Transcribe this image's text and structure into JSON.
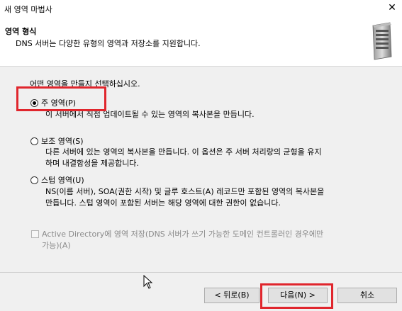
{
  "window": {
    "title": "새 영역 마법사",
    "close_glyph": "✕"
  },
  "header": {
    "title": "영역 형식",
    "subtitle": "DNS 서버는 다양한 유형의 영역과 저장소를 지원합니다."
  },
  "prompt": "어떤 영역을 만들지 선택하십시오.",
  "options": [
    {
      "label": "주 영역(P)",
      "checked": true,
      "description": "이 서버에서 직접 업데이트될 수 있는 영역의 복사본을 만듭니다."
    },
    {
      "label": "보조 영역(S)",
      "checked": false,
      "description_lines": [
        "다른 서버에 있는 영역의 복사본을 만듭니다. 이 옵션은 주 서버 처리량의 균형을 유지",
        "하며 내결함성을 제공합니다."
      ]
    },
    {
      "label": "스텁 영역(U)",
      "checked": false,
      "description_lines": [
        "NS(이름 서버), SOA(권한 시작) 및 글루 호스트(A) 레코드만 포함된 영역의 복사본을",
        "만듭니다. 스텁 영역이 포함된 서버는 해당 영역에 대한 권한이 없습니다."
      ]
    }
  ],
  "ad_checkbox": {
    "lines": [
      "Active Directory에 영역 저장(DNS 서버가 쓰기 가능한 도메인 컨트롤러인 경우에만",
      "가능)(A)"
    ],
    "checked": false,
    "enabled": false
  },
  "buttons": {
    "back": "< 뒤로(B)",
    "next": "다음(N) >",
    "cancel": "취소"
  },
  "colors": {
    "highlight": "#e0262d",
    "window_bg": "#f0f0f0"
  },
  "icons": {
    "header": "server-icon"
  }
}
